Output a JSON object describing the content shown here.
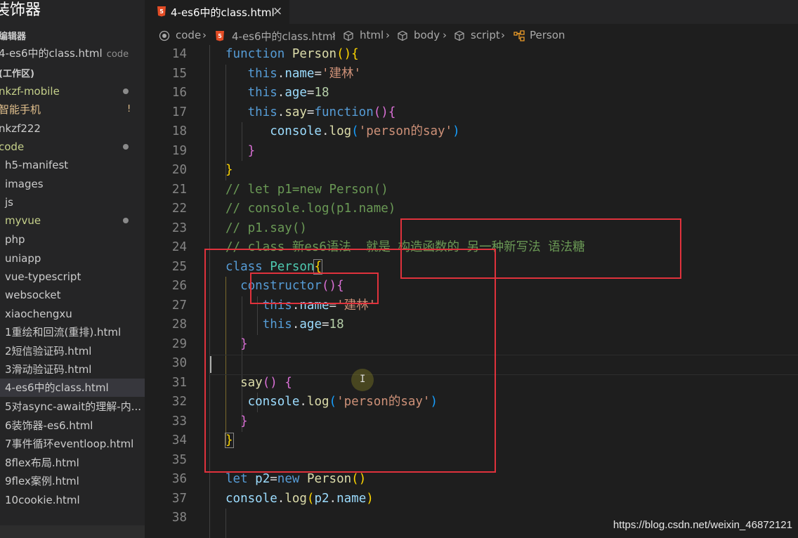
{
  "sidebar": {
    "title": "装饰器",
    "open_editors_label": "编辑器",
    "open_file": "4-es6中的class.html",
    "open_file_folder": "code",
    "workspace_label": "(工作区)",
    "items": [
      {
        "label": "nkzf-mobile"
      },
      {
        "label": "智能手机",
        "badge": "!"
      },
      {
        "label": "nkzf222"
      },
      {
        "label": "code"
      },
      {
        "label": "h5-manifest"
      },
      {
        "label": "images"
      },
      {
        "label": "js"
      },
      {
        "label": "myvue"
      },
      {
        "label": "php"
      },
      {
        "label": "uniapp"
      },
      {
        "label": "vue-typescript"
      },
      {
        "label": "websocket"
      },
      {
        "label": "xiaochengxu"
      },
      {
        "label": "1重绘和回流(重排).html"
      },
      {
        "label": "2短信验证码.html"
      },
      {
        "label": "3滑动验证码.html"
      },
      {
        "label": "4-es6中的class.html"
      },
      {
        "label": "5对async-await的理解-内..."
      },
      {
        "label": "6装饰器-es6.html"
      },
      {
        "label": "7事件循环eventloop.html"
      },
      {
        "label": "8flex布局.html"
      },
      {
        "label": "9flex案例.html"
      },
      {
        "label": "10cookie.html"
      }
    ]
  },
  "tab": {
    "label": "4-es6中的class.html",
    "close": "×"
  },
  "breadcrumb": {
    "code": "code",
    "file": "4-es6中的class.html",
    "html": "html",
    "body": "body",
    "script": "script",
    "symbol": "Person"
  },
  "editor": {
    "line_numbers": [
      "14",
      "15",
      "16",
      "17",
      "18",
      "19",
      "20",
      "21",
      "22",
      "23",
      "24",
      "25",
      "26",
      "27",
      "28",
      "29",
      "30",
      "31",
      "32",
      "33",
      "34",
      "35",
      "36",
      "37",
      "38"
    ]
  },
  "watermark": "https://blog.csdn.net/weixin_46872121",
  "colors": {
    "annotation_box": "#e0323c",
    "keyword": "#569cd6",
    "string": "#ce9178",
    "comment": "#6a9955"
  }
}
